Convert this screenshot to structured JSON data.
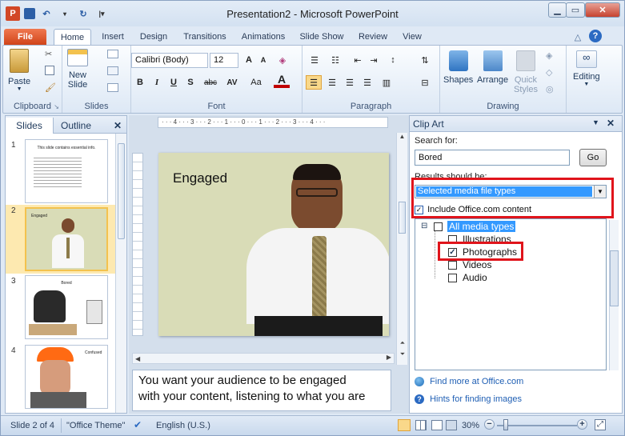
{
  "window": {
    "title": "Presentation2 - Microsoft PowerPoint"
  },
  "qat": {
    "app_icon": "P",
    "save_icon": "save-icon",
    "undo_icon": "undo-icon",
    "redo_icon": "redo-icon"
  },
  "tabs": {
    "file": "File",
    "items": [
      "Home",
      "Insert",
      "Design",
      "Transitions",
      "Animations",
      "Slide Show",
      "Review",
      "View"
    ]
  },
  "ribbon": {
    "clipboard": {
      "label": "Clipboard",
      "paste": "Paste"
    },
    "slides": {
      "label": "Slides",
      "new_slide_1": "New",
      "new_slide_2": "Slide"
    },
    "font": {
      "label": "Font",
      "font_name": "Calibri (Body)",
      "font_size": "12",
      "bold": "B",
      "italic": "I",
      "underline": "U",
      "strike_s": "S",
      "abc": "abc",
      "spacing": "AV",
      "case": "Aa",
      "color": "A",
      "grow": "A",
      "shrink": "A"
    },
    "paragraph": {
      "label": "Paragraph"
    },
    "drawing": {
      "label": "Drawing",
      "shapes": "Shapes",
      "arrange": "Arrange",
      "quick_styles_1": "Quick",
      "quick_styles_2": "Styles"
    },
    "editing": {
      "label": "Editing"
    }
  },
  "left_pane": {
    "tab_slides": "Slides",
    "tab_outline": "Outline",
    "close": "✕",
    "thumbs": [
      {
        "num": "1",
        "title": "This slide contains essential info."
      },
      {
        "num": "2",
        "title": "Engaged"
      },
      {
        "num": "3",
        "title": "Bored"
      },
      {
        "num": "4",
        "title": "Confused"
      }
    ]
  },
  "slide": {
    "title": "Engaged"
  },
  "ruler_text": "· · · 4 · · · 3 · · · 2 · · · 1 · · · 0 · · · 1 · · · 2 · · · 3 · · · 4 · · ·",
  "notes": {
    "line1": "You want your audience to be engaged",
    "line2": "with your content, listening to what you are"
  },
  "clipart": {
    "header": "Clip Art",
    "search_label": "Search for:",
    "search_value": "Bored",
    "go": "Go",
    "results_label": "Results should be:",
    "results_value": "Selected media file types",
    "include_office": "Include Office.com content",
    "tree": {
      "all": "All media types",
      "illustrations": "Illustrations",
      "photographs": "Photographs",
      "videos": "Videos",
      "audio": "Audio"
    },
    "find_more": "Find more at Office.com",
    "hints": "Hints for finding images"
  },
  "status": {
    "slide": "Slide 2 of 4",
    "theme": "\"Office Theme\"",
    "language": "English (U.S.)",
    "zoom": "30%",
    "minus": "−",
    "plus": "+"
  },
  "colors": {
    "accent": "#e0141b",
    "file_tab": "#d04419",
    "selection": "#3399ff"
  }
}
